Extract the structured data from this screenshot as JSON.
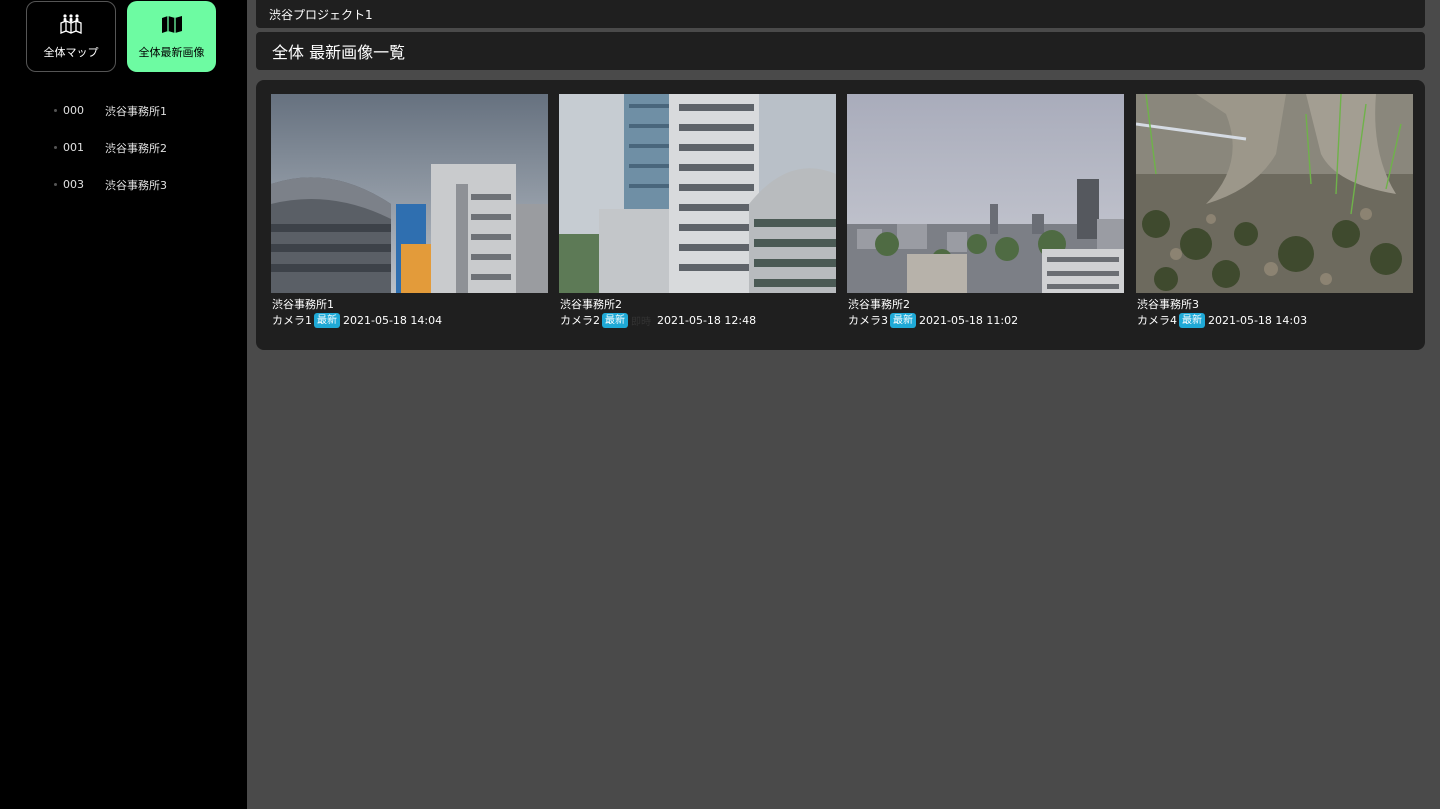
{
  "nav": {
    "map_label": "全体マップ",
    "latest_label": "全体最新画像"
  },
  "sites": [
    {
      "code": "000",
      "name": "渋谷事務所1"
    },
    {
      "code": "001",
      "name": "渋谷事務所2"
    },
    {
      "code": "003",
      "name": "渋谷事務所3"
    }
  ],
  "project_name": "渋谷プロジェクト1",
  "page_title": "全体 最新画像一覧",
  "images": [
    {
      "site": "渋谷事務所1",
      "camera": "カメラ1",
      "badge": "最新",
      "extra": "",
      "datetime": "2021-05-18 14:04"
    },
    {
      "site": "渋谷事務所2",
      "camera": "カメラ2",
      "badge": "最新",
      "extra": "即時",
      "datetime": "2021-05-18 12:48"
    },
    {
      "site": "渋谷事務所2",
      "camera": "カメラ3",
      "badge": "最新",
      "extra": "",
      "datetime": "2021-05-18 11:02"
    },
    {
      "site": "渋谷事務所3",
      "camera": "カメラ4",
      "badge": "最新",
      "extra": "",
      "datetime": "2021-05-18 14:03"
    }
  ],
  "colors": {
    "accent_green": "#6dfba2",
    "badge_blue": "#1fa9d6",
    "panel": "#1f1f1f",
    "background": "#4a4a4a"
  }
}
